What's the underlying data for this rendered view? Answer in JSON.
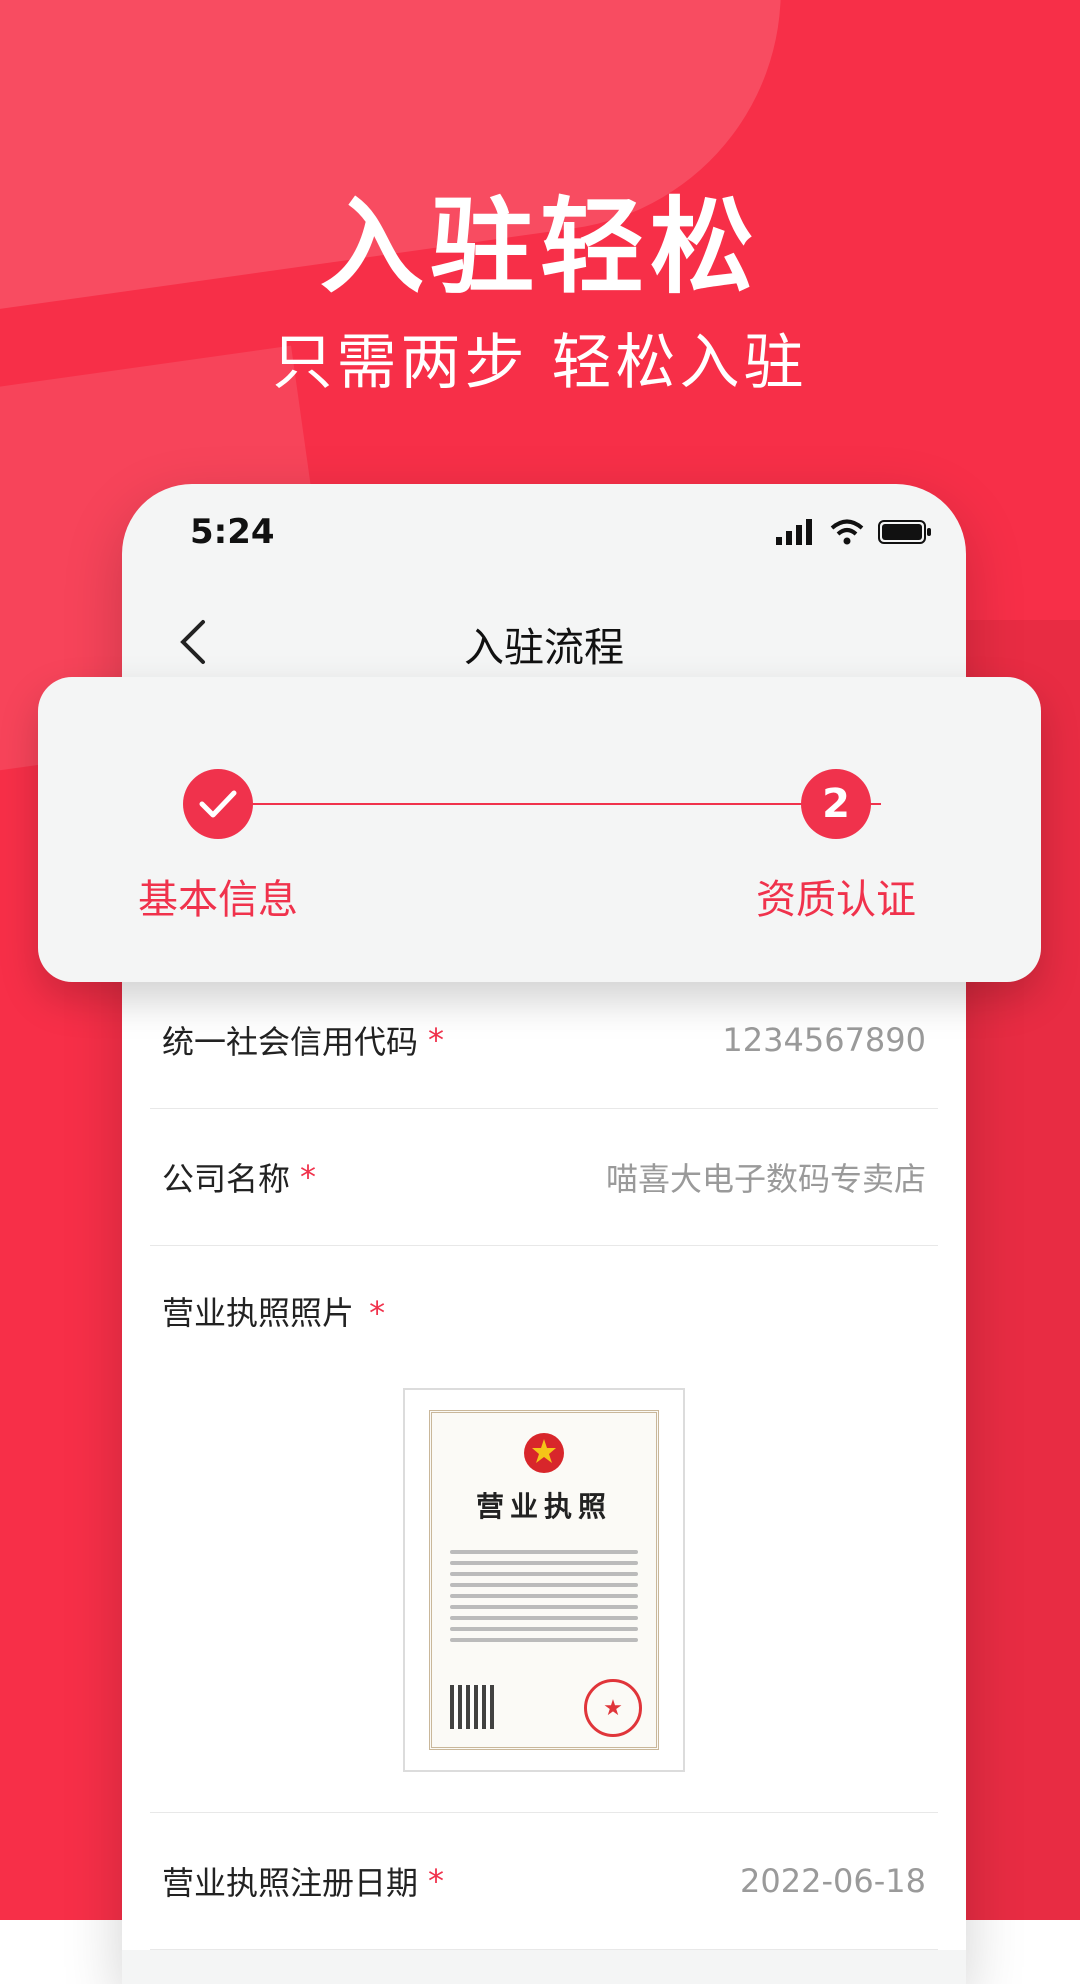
{
  "hero": {
    "title": "入驻轻松",
    "subtitle": "只需两步  轻松入驻"
  },
  "status_bar": {
    "time": "5:24"
  },
  "nav": {
    "title": "入驻流程"
  },
  "steps": [
    {
      "label": "基本信息",
      "state": "done"
    },
    {
      "label": "资质认证",
      "number": "2",
      "state": "current"
    }
  ],
  "form": {
    "credit_code": {
      "label": "统一社会信用代码",
      "required": "*",
      "value": "1234567890"
    },
    "company_name": {
      "label": "公司名称",
      "required": "*",
      "value": "喵喜大电子数码专卖店"
    },
    "license_photo": {
      "label": "营业执照照片",
      "required": "*",
      "image_text": "营业执照"
    },
    "register_date": {
      "label": "营业执照注册日期",
      "required": "*",
      "value": "2022-06-18"
    }
  },
  "colors": {
    "accent": "#f0324c",
    "background": "#f72f48"
  }
}
